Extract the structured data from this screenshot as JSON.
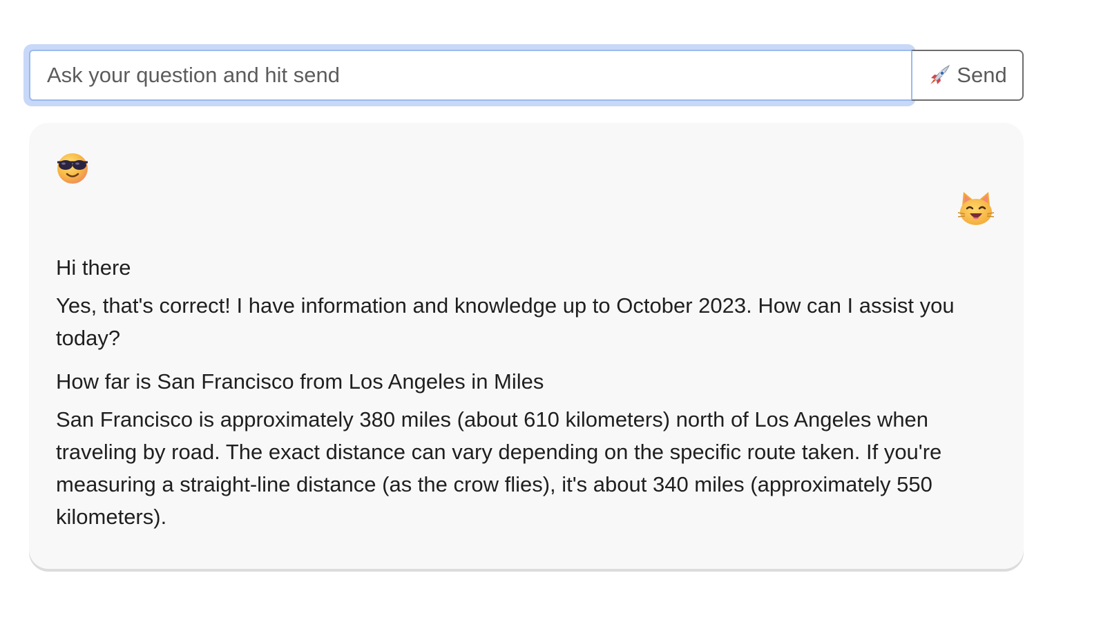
{
  "input": {
    "placeholder": "Ask your question and hit send",
    "value": ""
  },
  "send_button": {
    "label": "Send",
    "icon": "rocket-icon"
  },
  "avatars": {
    "user": "sunglasses-face-icon",
    "bot": "cat-face-icon"
  },
  "messages": [
    {
      "role": "user",
      "text": "Hi there"
    },
    {
      "role": "assistant",
      "text": "Yes, that's correct! I have information and knowledge up to October 2023. How can I assist you today?"
    },
    {
      "role": "user",
      "text": "How far is San Francisco from Los Angeles in Miles"
    },
    {
      "role": "assistant",
      "text": "San Francisco is approximately 380 miles (about 610 kilometers) north of Los Angeles when traveling by road. The exact distance can vary depending on the specific route taken. If you're measuring a straight-line distance (as the crow flies), it's about 340 miles (approximately 550 kilometers)."
    }
  ],
  "colors": {
    "focus_ring": "#c8d8f8",
    "panel_background": "#f8f8f8",
    "text": "#1f1f1f"
  }
}
